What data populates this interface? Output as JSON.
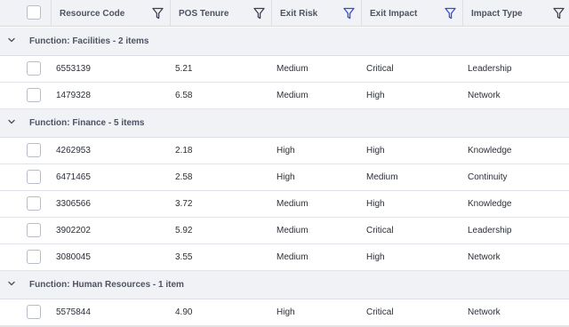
{
  "columns": [
    {
      "label": "Resource Code",
      "filter_icon": "filter-icon",
      "filter_active": false
    },
    {
      "label": "POS Tenure",
      "filter_icon": "filter-icon",
      "filter_active": false
    },
    {
      "label": "Exit Risk",
      "filter_icon": "filter-icon",
      "filter_active": true
    },
    {
      "label": "Exit Impact",
      "filter_icon": "filter-icon",
      "filter_active": true
    },
    {
      "label": "Impact Type",
      "filter_icon": "filter-icon",
      "filter_active": false
    }
  ],
  "colors": {
    "filter_active": "#2f4cdd",
    "filter_inactive": "#3b4150",
    "header_bg": "#f1f2f5",
    "border": "#dcdfe5"
  },
  "groups": [
    {
      "label": "Function: Facilities - 2 items",
      "rows": [
        {
          "code": "6553139",
          "tenure": "5.21",
          "risk": "Medium",
          "impact": "Critical",
          "type": "Leadership"
        },
        {
          "code": "1479328",
          "tenure": "6.58",
          "risk": "Medium",
          "impact": "High",
          "type": "Network"
        }
      ]
    },
    {
      "label": "Function: Finance - 5 items",
      "rows": [
        {
          "code": "4262953",
          "tenure": "2.18",
          "risk": "High",
          "impact": "High",
          "type": "Knowledge"
        },
        {
          "code": "6471465",
          "tenure": "2.58",
          "risk": "High",
          "impact": "Medium",
          "type": "Continuity"
        },
        {
          "code": "3306566",
          "tenure": "3.72",
          "risk": "Medium",
          "impact": "High",
          "type": "Knowledge"
        },
        {
          "code": "3902202",
          "tenure": "5.92",
          "risk": "Medium",
          "impact": "Critical",
          "type": "Leadership"
        },
        {
          "code": "3080045",
          "tenure": "3.55",
          "risk": "Medium",
          "impact": "High",
          "type": "Network"
        }
      ]
    },
    {
      "label": "Function: Human Resources - 1 item",
      "rows": [
        {
          "code": "5575844",
          "tenure": "4.90",
          "risk": "High",
          "impact": "Critical",
          "type": "Network"
        }
      ]
    }
  ]
}
